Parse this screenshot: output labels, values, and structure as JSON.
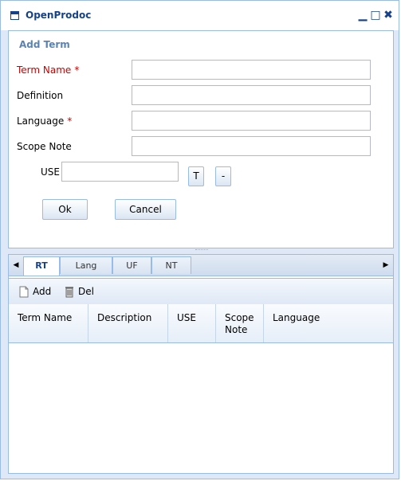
{
  "window": {
    "title": "OpenProdoc",
    "icons": {
      "app": "window-icon",
      "minimize": "minimize-icon",
      "maximize": "maximize-icon",
      "close": "close-icon"
    },
    "minimize_glyph": "▁",
    "maximize_glyph": "□",
    "close_glyph": "✖"
  },
  "form": {
    "heading": "Add Term",
    "term_name_label": "Term Name",
    "definition_label": "Definition",
    "language_label": "Language",
    "scope_note_label": "Scope Note",
    "use_label": "USE",
    "required_mark": "*",
    "term_name_value": "",
    "definition_value": "",
    "language_value": "",
    "scope_note_value": "",
    "use_value": "",
    "t_button": "T",
    "minus_button": "-",
    "ok_button": "Ok",
    "cancel_button": "Cancel"
  },
  "tabs": {
    "items": [
      "RT",
      "Lang",
      "UF",
      "NT"
    ],
    "active": "RT",
    "scroll_left_glyph": "◀",
    "scroll_right_glyph": "▶"
  },
  "toolbar": {
    "add_label": "Add",
    "del_label": "Del"
  },
  "grid": {
    "columns": [
      "Term Name",
      "Description",
      "USE",
      "Scope Note",
      "Language"
    ],
    "rows": []
  },
  "colors": {
    "required": "#cc0000",
    "heading": "#5b83b3",
    "border": "#99bbe8",
    "title": "#15428b"
  }
}
